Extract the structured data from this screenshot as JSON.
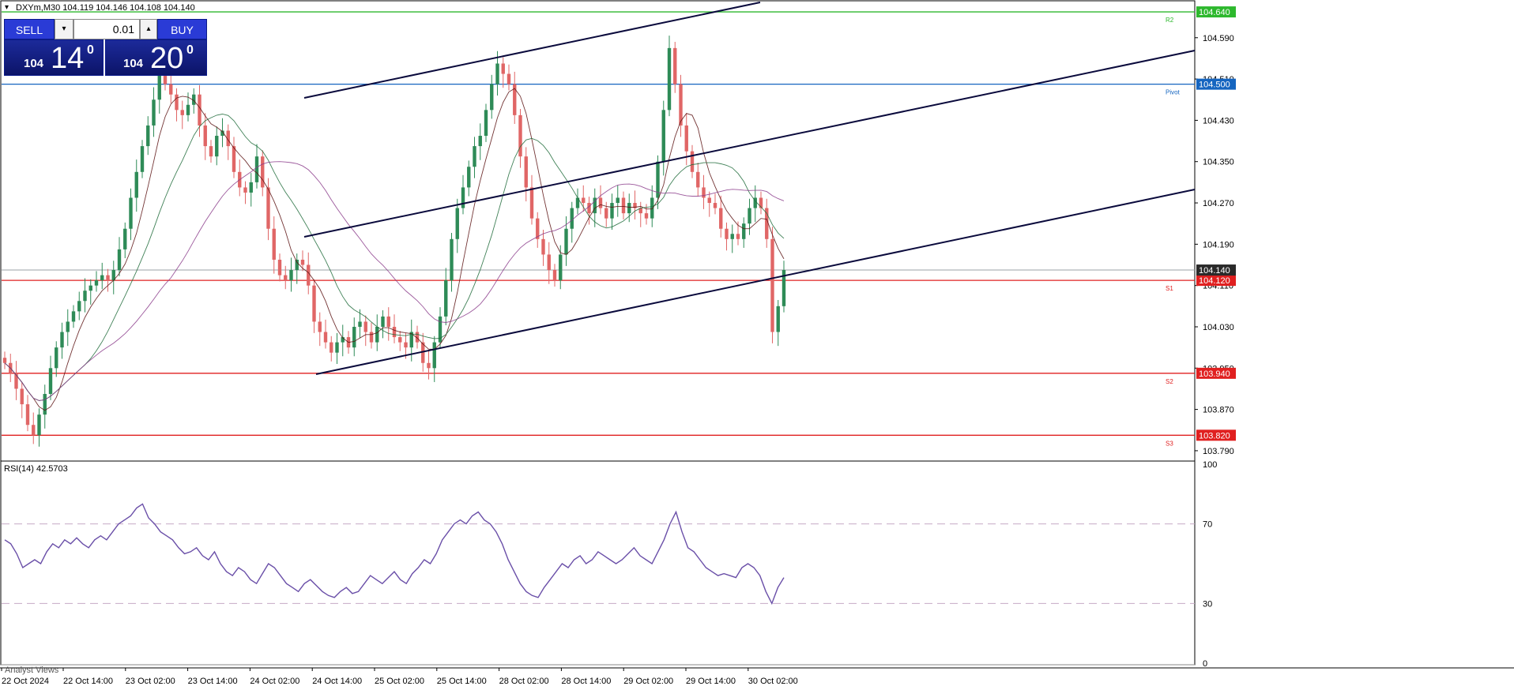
{
  "symbol_line": {
    "text": "DXYm,M30  104.119 104.146 104.108 104.140"
  },
  "trade_panel": {
    "sell_label": "SELL",
    "buy_label": "BUY",
    "volume": "0.01",
    "sell_quote": {
      "prefix": "104",
      "big": "14",
      "sup": "0"
    },
    "buy_quote": {
      "prefix": "104",
      "big": "20",
      "sup": "0"
    }
  },
  "indicator": {
    "rsi_label": "RSI(14) 42.5703"
  },
  "analyst_views": "Analyst Views",
  "colors": {
    "bull": "#2e8b57",
    "bear": "#e06666",
    "support": "#e02020",
    "resistance": "#2db82d",
    "pivot": "#1565c0",
    "channel": "#0a0a3c",
    "rsi": "#6a4fa8",
    "axis_bg_current": "#2a2a2a"
  },
  "chart_data": {
    "type": "candlestick",
    "price_range": [
      103.77,
      104.66
    ],
    "price_ticks": [
      "104.590",
      "104.510",
      "104.430",
      "104.350",
      "104.270",
      "104.190",
      "104.110",
      "104.030",
      "103.950",
      "103.870",
      "103.790"
    ],
    "levels": [
      {
        "value": 104.64,
        "label": "104.640",
        "tag": "R2",
        "color": "#2db82d"
      },
      {
        "value": 104.5,
        "label": "104.500",
        "tag": "Pivot",
        "color": "#1565c0"
      },
      {
        "value": 104.12,
        "label": "104.120",
        "tag": "S1",
        "color": "#e02020"
      },
      {
        "value": 103.94,
        "label": "103.940",
        "tag": "S2",
        "color": "#e02020"
      },
      {
        "value": 103.82,
        "label": "103.820",
        "tag": "S3",
        "color": "#e02020"
      }
    ],
    "current_price": {
      "value": 104.14,
      "label": "104.140"
    },
    "time_labels": [
      "22 Oct 2024",
      "22 Oct 14:00",
      "23 Oct 02:00",
      "23 Oct 14:00",
      "24 Oct 02:00",
      "24 Oct 14:00",
      "25 Oct 02:00",
      "25 Oct 14:00",
      "28 Oct 02:00",
      "28 Oct 14:00",
      "29 Oct 02:00",
      "29 Oct 14:00",
      "30 Oct 02:00"
    ],
    "close_path": [
      103.96,
      103.94,
      103.91,
      103.88,
      103.84,
      103.82,
      103.86,
      103.9,
      103.95,
      103.99,
      104.02,
      104.04,
      104.06,
      104.08,
      104.1,
      104.11,
      104.12,
      104.13,
      104.12,
      104.14,
      104.18,
      104.22,
      104.28,
      104.33,
      104.38,
      104.42,
      104.47,
      104.52,
      104.5,
      104.48,
      104.45,
      104.44,
      104.46,
      104.48,
      104.42,
      104.38,
      104.36,
      104.4,
      104.41,
      104.38,
      104.33,
      104.3,
      104.29,
      104.31,
      104.36,
      104.3,
      104.22,
      104.16,
      104.13,
      104.12,
      104.14,
      104.16,
      104.15,
      104.11,
      104.04,
      104.02,
      104.0,
      103.98,
      104.0,
      104.01,
      103.99,
      104.03,
      104.04,
      104.02,
      104.0,
      104.03,
      104.05,
      104.03,
      104.01,
      104.0,
      103.99,
      104.02,
      104.0,
      103.96,
      103.95,
      104.0,
      104.05,
      104.12,
      104.2,
      104.26,
      104.3,
      104.34,
      104.38,
      104.4,
      104.45,
      104.5,
      104.54,
      104.52,
      104.5,
      104.44,
      104.36,
      104.3,
      104.24,
      104.2,
      104.17,
      104.14,
      104.12,
      104.17,
      104.22,
      104.26,
      104.28,
      104.27,
      104.25,
      104.28,
      104.26,
      104.24,
      104.27,
      104.28,
      104.25,
      104.27,
      104.26,
      104.25,
      104.24,
      104.28,
      104.35,
      104.45,
      104.57,
      104.5,
      104.42,
      104.37,
      104.33,
      104.3,
      104.28,
      104.27,
      104.26,
      104.22,
      104.2,
      104.21,
      104.2,
      104.23,
      104.26,
      104.28,
      104.26,
      104.2,
      104.02,
      104.07,
      104.14
    ],
    "rsi": {
      "range": [
        0,
        100
      ],
      "levels": [
        70,
        30
      ],
      "ticks": [
        "100",
        "70",
        "30",
        "0"
      ],
      "path": [
        62,
        60,
        55,
        48,
        50,
        52,
        50,
        56,
        60,
        58,
        62,
        60,
        63,
        60,
        58,
        62,
        64,
        62,
        66,
        70,
        72,
        74,
        78,
        80,
        73,
        70,
        66,
        64,
        62,
        58,
        55,
        56,
        58,
        54,
        52,
        56,
        50,
        46,
        44,
        48,
        46,
        42,
        40,
        45,
        50,
        48,
        44,
        40,
        38,
        36,
        40,
        42,
        39,
        36,
        34,
        33,
        36,
        38,
        35,
        36,
        40,
        44,
        42,
        40,
        43,
        46,
        42,
        40,
        45,
        48,
        52,
        50,
        55,
        62,
        66,
        70,
        72,
        70,
        74,
        76,
        72,
        70,
        66,
        60,
        52,
        46,
        40,
        36,
        34,
        33,
        38,
        42,
        46,
        50,
        48,
        52,
        54,
        50,
        52,
        56,
        54,
        52,
        50,
        52,
        55,
        58,
        54,
        52,
        50,
        56,
        62,
        70,
        76,
        66,
        58,
        56,
        52,
        48,
        46,
        44,
        45,
        44,
        43,
        48,
        50,
        48,
        44,
        36,
        30,
        38,
        43
      ]
    }
  }
}
